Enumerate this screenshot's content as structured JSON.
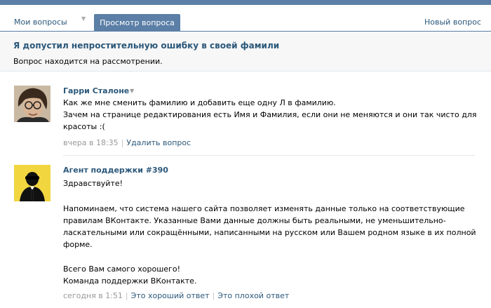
{
  "tabs": {
    "my_questions": "Мои вопросы",
    "view_question": "Просмотр вопроса",
    "new_question": "Новый вопрос"
  },
  "question": {
    "title": "Я допустил непростительную ошибку в своей фамили",
    "status": "Вопрос находится на рассмотрении."
  },
  "post1": {
    "author": "Гарри Сталоне",
    "lines": [
      "Как же мне сменить фамилию и добавить еще одну Л в фамилию.",
      "Зачем на странице редактирования есть Имя и Фамилия, если они не меняются и они так чисто для",
      "красоты :("
    ],
    "time": "вчера в 18:35",
    "delete_link": "Удалить вопрос"
  },
  "post2": {
    "author": "Агент поддержки #390",
    "greeting": "Здравствуйте!",
    "body": [
      "Напоминаем, что система нашего сайта позволяет изменять данные только на соответствующие",
      "правилам ВКонтакте. Указанные Вами данные должны быть реальными, не уменьшительно-",
      "ласкательными или сокращёнными, написанными на русском или Вашем родном языке в их полной",
      "форме."
    ],
    "closing": [
      "Всего Вам самого хорошего!",
      "Команда поддержки ВКонтакте."
    ],
    "time": "сегодня в 1:51",
    "good_link": "Это хороший ответ",
    "bad_link": "Это плохой ответ"
  }
}
